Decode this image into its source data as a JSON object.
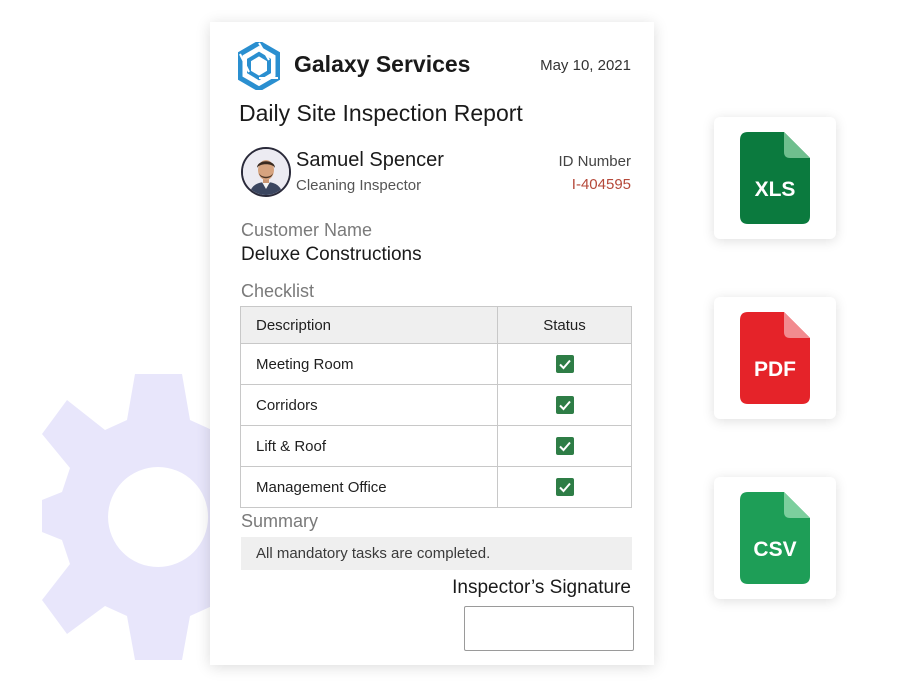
{
  "header": {
    "company_name": "Galaxy Services",
    "date": "May 10, 2021",
    "report_title": "Daily Site Inspection Report"
  },
  "inspector": {
    "name": "Samuel Spencer",
    "role": "Cleaning Inspector",
    "id_label": "ID Number",
    "id_value": "I-404595"
  },
  "customer": {
    "label": "Customer Name",
    "value": "Deluxe Constructions"
  },
  "checklist": {
    "label": "Checklist",
    "columns": [
      "Description",
      "Status"
    ],
    "rows": [
      {
        "description": "Meeting Room",
        "checked": true
      },
      {
        "description": "Corridors",
        "checked": true
      },
      {
        "description": "Lift & Roof",
        "checked": true
      },
      {
        "description": "Management Office",
        "checked": true
      }
    ]
  },
  "summary": {
    "label": "Summary",
    "text": "All mandatory tasks are completed."
  },
  "signature": {
    "label": "Inspector’s Signature"
  },
  "exports": [
    {
      "label": "XLS",
      "color": "#0b7a3e"
    },
    {
      "label": "PDF",
      "color": "#e52329"
    },
    {
      "label": "CSV",
      "color": "#1e9e57"
    }
  ],
  "colors": {
    "gear": "#e8e6fb",
    "logo_blue": "#2a8fd0",
    "check_green": "#2e7d46",
    "id_red": "#b5493a"
  }
}
